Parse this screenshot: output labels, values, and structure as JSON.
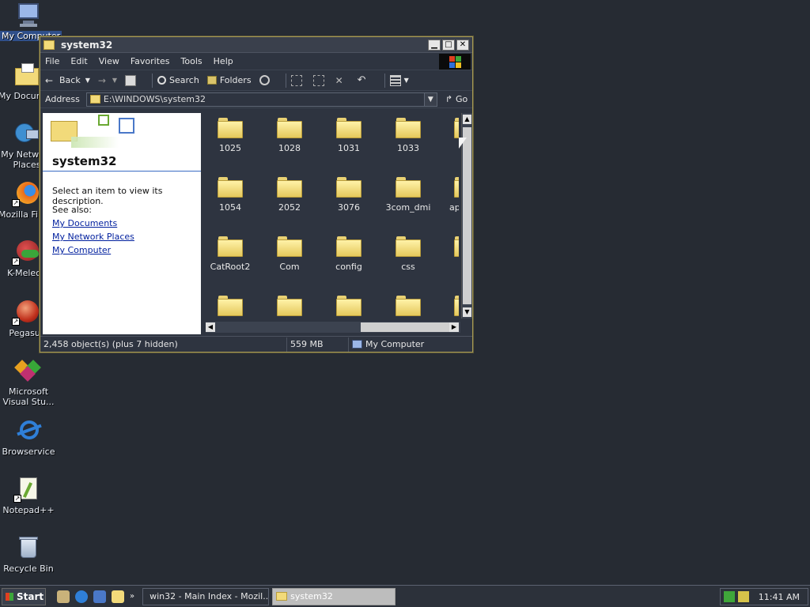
{
  "desktop": {
    "icons": [
      {
        "label": "My Computer",
        "selected": true
      },
      {
        "label": "My Documents"
      },
      {
        "label": "My Network Places",
        "label_line1": "My Network",
        "label_line2": "Places"
      },
      {
        "label": "Mozilla Firefox"
      },
      {
        "label": "K-Meleon"
      },
      {
        "label": "Pegasus"
      },
      {
        "label": "Microsoft Visual Studio",
        "label_line1": "Microsoft",
        "label_line2": "Visual Stu..."
      },
      {
        "label": "Browservice"
      },
      {
        "label": "Notepad++"
      },
      {
        "label": "Recycle Bin"
      }
    ]
  },
  "window": {
    "title": "system32",
    "menu": [
      "File",
      "Edit",
      "View",
      "Favorites",
      "Tools",
      "Help"
    ],
    "toolbar": {
      "back": "Back",
      "search": "Search",
      "folders": "Folders"
    },
    "address": {
      "label": "Address",
      "value": "E:\\WINDOWS\\system32",
      "go": "Go"
    },
    "leftpane": {
      "title": "system32",
      "description": "Select an item to view its description.",
      "see_also": "See also:",
      "links": [
        "My Documents",
        "My Network Places",
        "My Computer"
      ]
    },
    "folders": [
      [
        "1025",
        "1028",
        "1031",
        "1033"
      ],
      [
        "1054",
        "2052",
        "3076",
        "3com_dmi"
      ],
      [
        "CatRoot2",
        "Com",
        "config",
        "css"
      ],
      [
        "",
        "",
        "",
        ""
      ]
    ],
    "partial_column_labels": [
      "ap"
    ],
    "status": {
      "objects": "2,458 object(s) (plus 7 hidden)",
      "size": "559 MB",
      "zone": "My Computer"
    }
  },
  "taskbar": {
    "start": "Start",
    "tasks": [
      {
        "label": "win32 - Main Index - Mozil..."
      },
      {
        "label": "system32",
        "active": true
      }
    ],
    "clock": "11:41 AM"
  },
  "colors": {
    "desktop_bg": "#262b33",
    "window_border": "#a69a55",
    "folder_yellow": "#f2da7a",
    "link_blue": "#001f9e"
  }
}
